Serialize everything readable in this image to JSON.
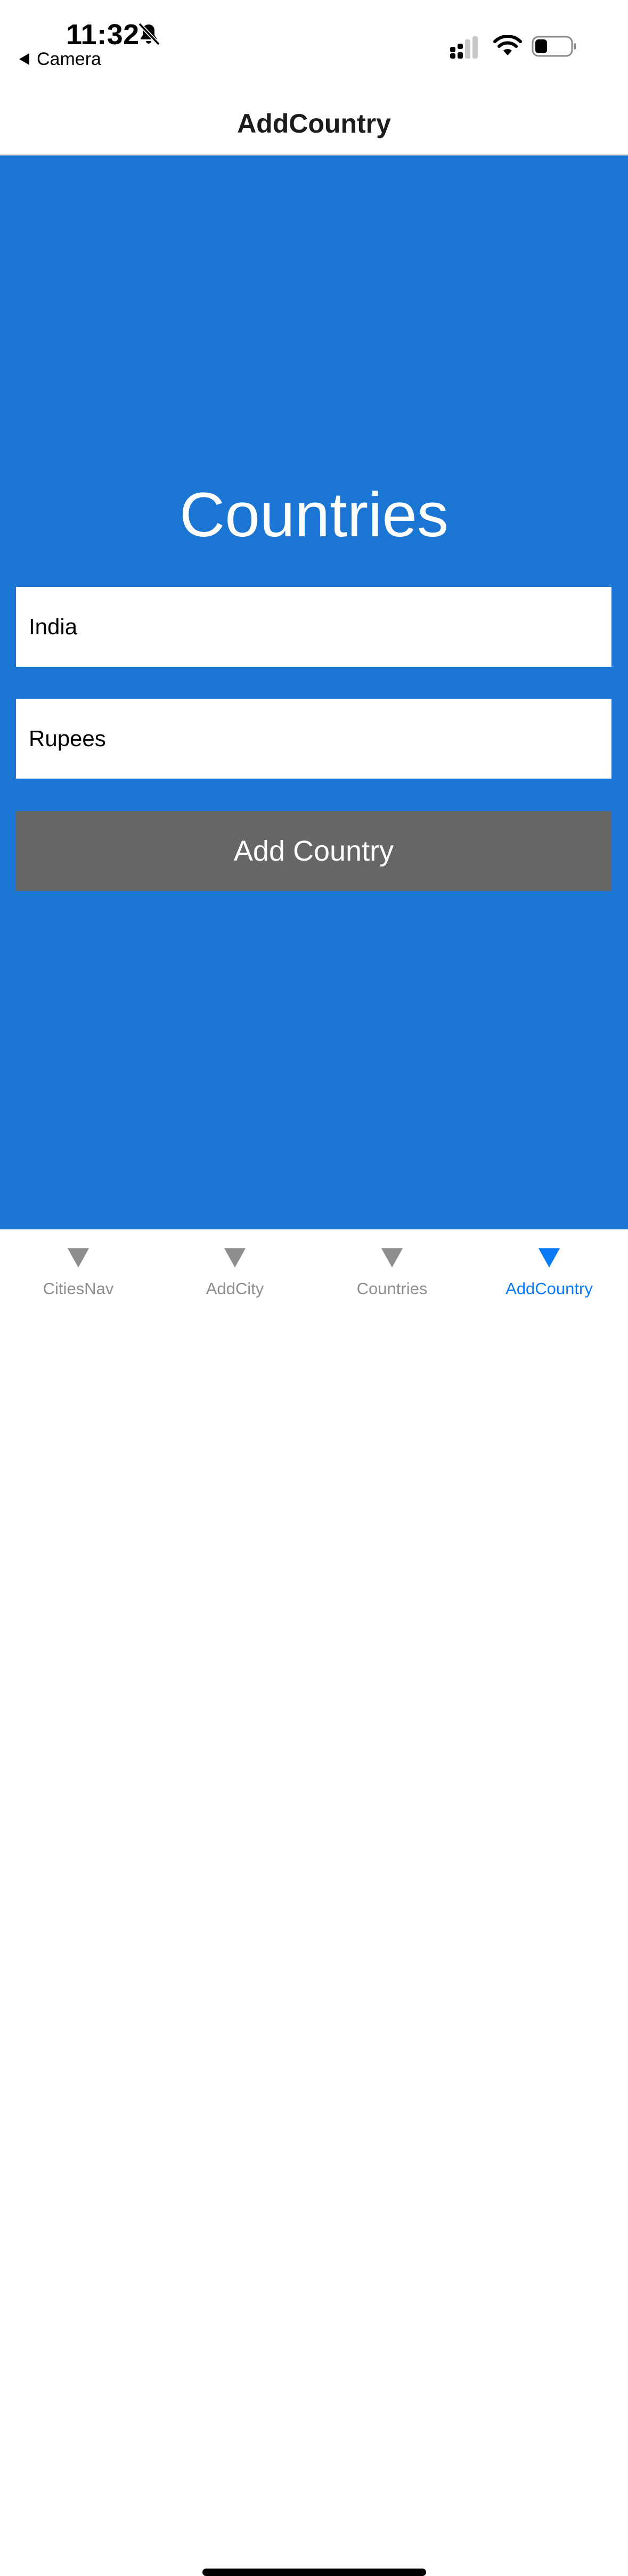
{
  "status_bar": {
    "time": "11:32",
    "back_app": "Camera",
    "icons": [
      "bell-slash-icon",
      "cellular-signal-icon",
      "wifi-icon",
      "battery-icon"
    ]
  },
  "header": {
    "title": "AddCountry"
  },
  "main": {
    "heading": "Countries",
    "country_input": {
      "value": "India"
    },
    "currency_input": {
      "value": "Rupees"
    },
    "add_button_label": "Add Country",
    "background_color": "#1b76d3",
    "button_color": "#666666"
  },
  "tabs": [
    {
      "label": "CitiesNav",
      "icon": "triangle-down-icon",
      "active": false
    },
    {
      "label": "AddCity",
      "icon": "triangle-down-icon",
      "active": false
    },
    {
      "label": "Countries",
      "icon": "triangle-down-icon",
      "active": false
    },
    {
      "label": "AddCountry",
      "icon": "triangle-down-icon",
      "active": true
    }
  ],
  "colors": {
    "tab_active": "#0a7bf5",
    "tab_inactive": "#8e8e8e"
  }
}
